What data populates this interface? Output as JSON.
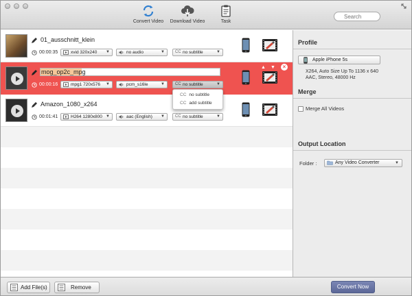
{
  "toolbar": {
    "convert_video": "Convert Video",
    "download_video": "Download Video",
    "task": "Task",
    "search_placeholder": "Search"
  },
  "files": [
    {
      "name": "01_ausschnitt_klein",
      "duration": "00:00:35",
      "video": "xvid 320x240",
      "audio": "no audio",
      "subtitle": "no subtitle"
    },
    {
      "name": "mog_op2c_mpg",
      "duration": "00:00:16",
      "video": "mpg1 720x576",
      "audio": "pcm_s16le",
      "subtitle": "no subtitle"
    },
    {
      "name": "Amazon_1080_x264",
      "duration": "00:01:41",
      "video": "H264 1280x800",
      "audio": "aac (English)",
      "subtitle": "no subtitle"
    }
  ],
  "subtitle_menu": {
    "cc_label": "CC",
    "items": [
      "no subtitle",
      "add subtitle"
    ]
  },
  "profile": {
    "title": "Profile",
    "device": "Apple iPhone 5s",
    "desc_line1": "X264, Auto Size Up To 1136 x 640",
    "desc_line2": "AAC, Stereo, 48000 Hz"
  },
  "merge": {
    "title": "Merge",
    "checkbox_label": "Merge All Videos",
    "checked": false
  },
  "output": {
    "title": "Output Location",
    "folder_label": "Folder :",
    "folder_value": "Any Video Converter"
  },
  "bottom": {
    "add_files": "Add File(s)",
    "remove": "Remove",
    "convert_now": "Convert Now"
  },
  "colors": {
    "selected_row": "#ef5350",
    "convert_button": "#5c6797",
    "toolbar_icon": "#2f7fd1"
  }
}
